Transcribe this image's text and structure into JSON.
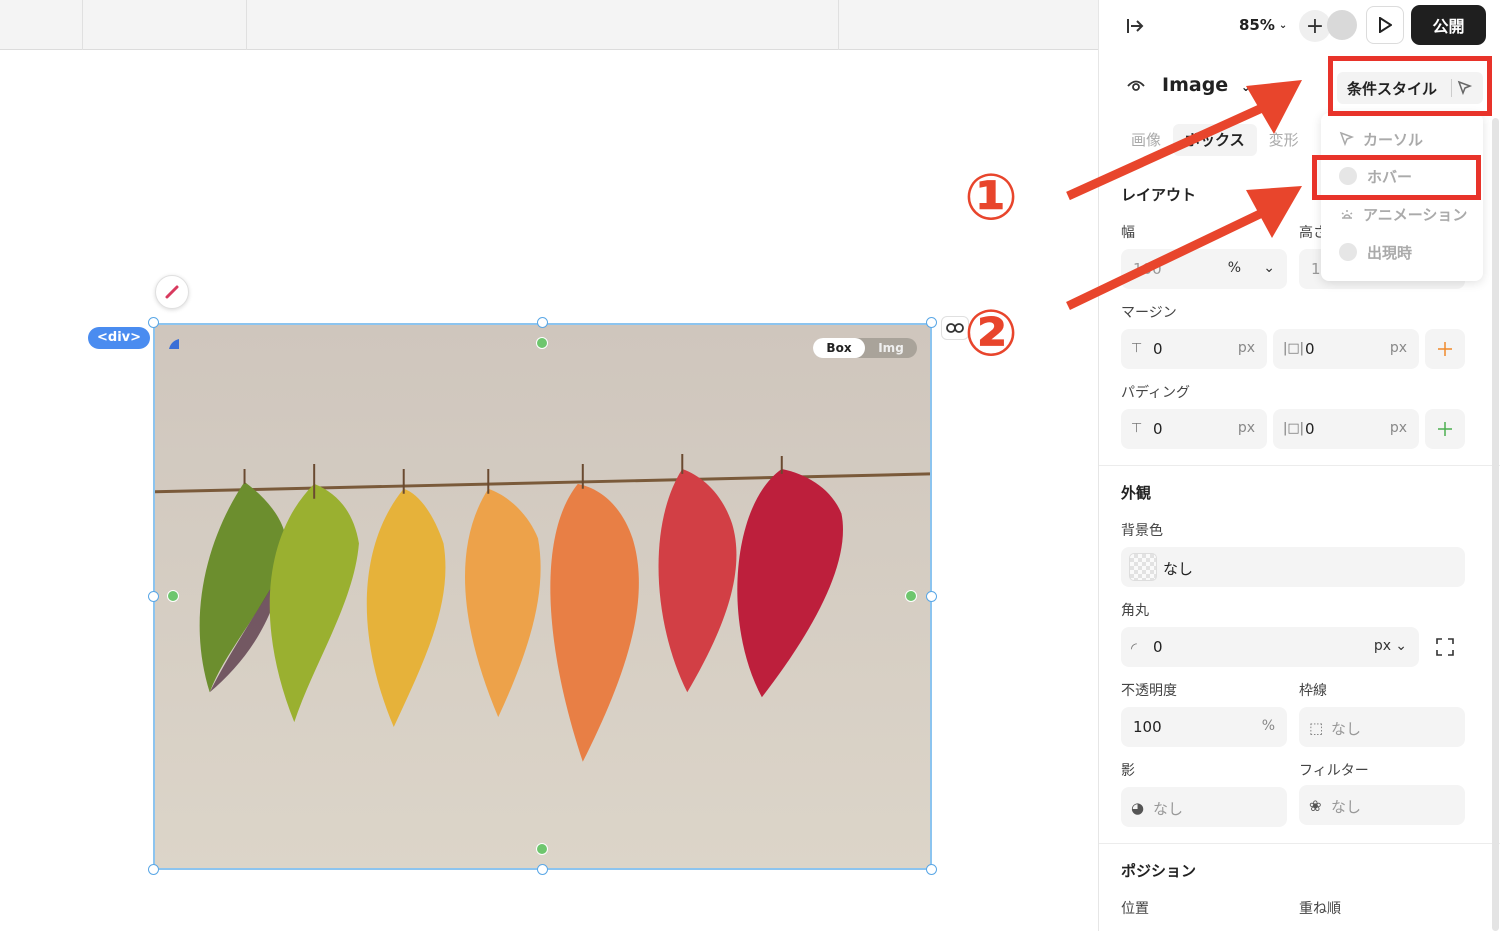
{
  "canvas": {
    "div_tag": "<div>",
    "toggle": {
      "box": "Box",
      "img": "Img"
    }
  },
  "annotations": {
    "one": "①",
    "two": "②"
  },
  "topbar": {
    "zoom": "85%",
    "publish": "公開"
  },
  "header": {
    "element_name": "Image",
    "conditional_style": "条件スタイル"
  },
  "dropdown": {
    "items": [
      "カーソル",
      "ホバー",
      "アニメーション",
      "出現時"
    ]
  },
  "tabs": [
    "画像",
    "ボックス",
    "変形"
  ],
  "layout": {
    "title": "レイアウト",
    "width_label": "幅",
    "width_value": "100",
    "width_unit": "%",
    "height_label": "高さ",
    "height_value": "100",
    "margin_label": "マージン",
    "margin_v": "0",
    "margin_h": "0",
    "padding_label": "パディング",
    "padding_v": "0",
    "padding_h": "0",
    "unit_px": "px"
  },
  "appearance": {
    "title": "外観",
    "bg_label": "背景色",
    "bg_value": "なし",
    "radius_label": "角丸",
    "radius_value": "0",
    "radius_unit": "px",
    "opacity_label": "不透明度",
    "opacity_value": "100",
    "opacity_unit": "%",
    "border_label": "枠線",
    "border_value": "なし",
    "shadow_label": "影",
    "shadow_value": "なし",
    "filter_label": "フィルター",
    "filter_value": "なし"
  },
  "position": {
    "title": "ポジション",
    "pos_label": "位置",
    "order_label": "重ね順"
  },
  "colors": {
    "accent_red": "#e8332a",
    "selection_blue": "#4a8cf0",
    "handle_green": "#6ec66e"
  }
}
